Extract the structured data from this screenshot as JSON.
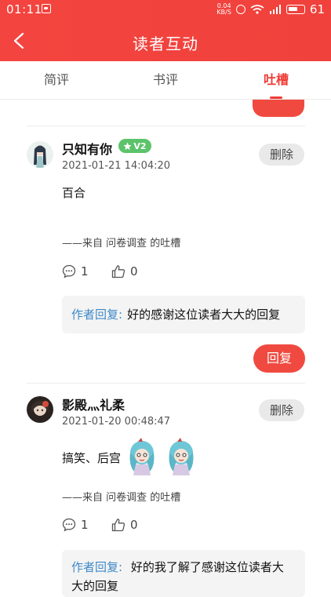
{
  "status_bar": {
    "time": "01:11",
    "net_speed_value": "0.04",
    "net_speed_unit": "KB/S",
    "battery": "61"
  },
  "header": {
    "title": "读者互动"
  },
  "tabs": [
    {
      "label": "简评",
      "active": false
    },
    {
      "label": "书评",
      "active": false
    },
    {
      "label": "吐槽",
      "active": true
    }
  ],
  "comments": [
    {
      "username": "只知有你",
      "vip_badge": "V2",
      "time": "2021-01-21 14:04:20",
      "delete_label": "删除",
      "content": "百合",
      "source": "——来自 问卷调查 的吐槽",
      "comment_count": "1",
      "like_count": "0",
      "reply_label": "作者回复:",
      "reply_text": "好的感谢这位读者大大的回复",
      "reply_button": "回复"
    },
    {
      "username": "影殿灬礼柔",
      "time": "2021-01-20 00:48:47",
      "delete_label": "删除",
      "content": "搞笑、后宫",
      "source": "——来自 问卷调查 的吐槽",
      "comment_count": "1",
      "like_count": "0",
      "reply_label": "作者回复:",
      "reply_text_line1": "好的我了解了感谢这位读者大",
      "reply_text_line2": "大的回复"
    }
  ],
  "colors": {
    "brand_red": "#f0413c",
    "reply_label_blue": "#3e89c8",
    "vip_green": "#5cc36a"
  }
}
